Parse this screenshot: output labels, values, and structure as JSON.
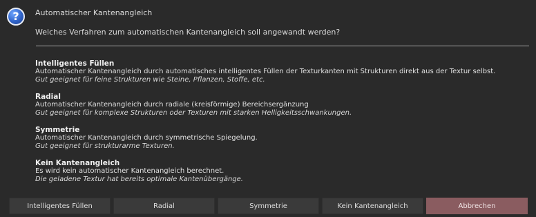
{
  "dialog": {
    "title": "Automatischer Kantenangleich",
    "question": "Welches Verfahren zum automatischen Kantenangleich soll angewandt werden?",
    "icon": "question-icon"
  },
  "options": [
    {
      "name": "Intelligentes Füllen",
      "desc": "Automatischer Kantenangleich durch automatisches intelligentes Füllen der Texturkanten mit Strukturen direkt aus der Textur selbst.",
      "hint": "Gut geeignet für feine Strukturen wie Steine, Pflanzen, Stoffe, etc."
    },
    {
      "name": "Radial",
      "desc": "Automatischer Kantenangleich durch radiale (kreisförmige) Bereichsergänzung",
      "hint": "Gut geeignet für komplexe Strukturen oder Texturen mit starken Helligkeitsschwankungen."
    },
    {
      "name": "Symmetrie",
      "desc": "Automatischer Kantenangleich durch symmetrische Spiegelung.",
      "hint": "Gut geeignet für strukturarme Texturen."
    },
    {
      "name": "Kein Kantenangleich",
      "desc": "Es wird kein automatischer Kantenangleich berechnet.",
      "hint": "Die geladene Textur hat bereits optimale Kantenübergänge."
    }
  ],
  "buttons": {
    "smart_fill": "Intelligentes Füllen",
    "radial": "Radial",
    "symmetry": "Symmetrie",
    "none": "Kein Kantenangleich",
    "cancel": "Abbrechen"
  },
  "colors": {
    "background": "#2a2a2a",
    "button": "#3a3a3a",
    "cancel_button": "#8a5c60",
    "icon_blue": "#2f63c9"
  }
}
